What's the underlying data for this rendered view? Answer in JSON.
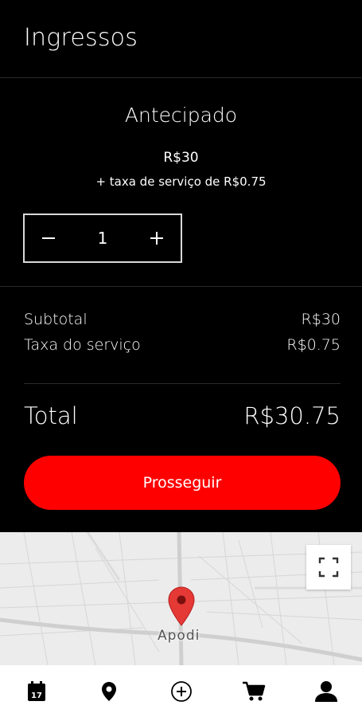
{
  "header": {
    "title": "Ingressos"
  },
  "ticket": {
    "name": "Antecipado",
    "price": "R$30",
    "fee_note": "+ taxa de serviço de R$0.75",
    "quantity": "1"
  },
  "summary": {
    "subtotal_label": "Subtotal",
    "subtotal_value": "R$30",
    "fee_label": "Taxa do serviço",
    "fee_value": "R$0.75",
    "total_label": "Total",
    "total_value": "R$30.75"
  },
  "actions": {
    "proceed_label": "Prosseguir"
  },
  "map": {
    "place_label": "Apodi"
  },
  "colors": {
    "accent": "#ff0000",
    "background": "#000000"
  },
  "tabbar": {
    "items": [
      {
        "icon": "calendar-icon",
        "calendar_day": "17"
      },
      {
        "icon": "location-pin-icon"
      },
      {
        "icon": "add-circle-icon"
      },
      {
        "icon": "cart-icon"
      },
      {
        "icon": "user-icon"
      }
    ]
  }
}
